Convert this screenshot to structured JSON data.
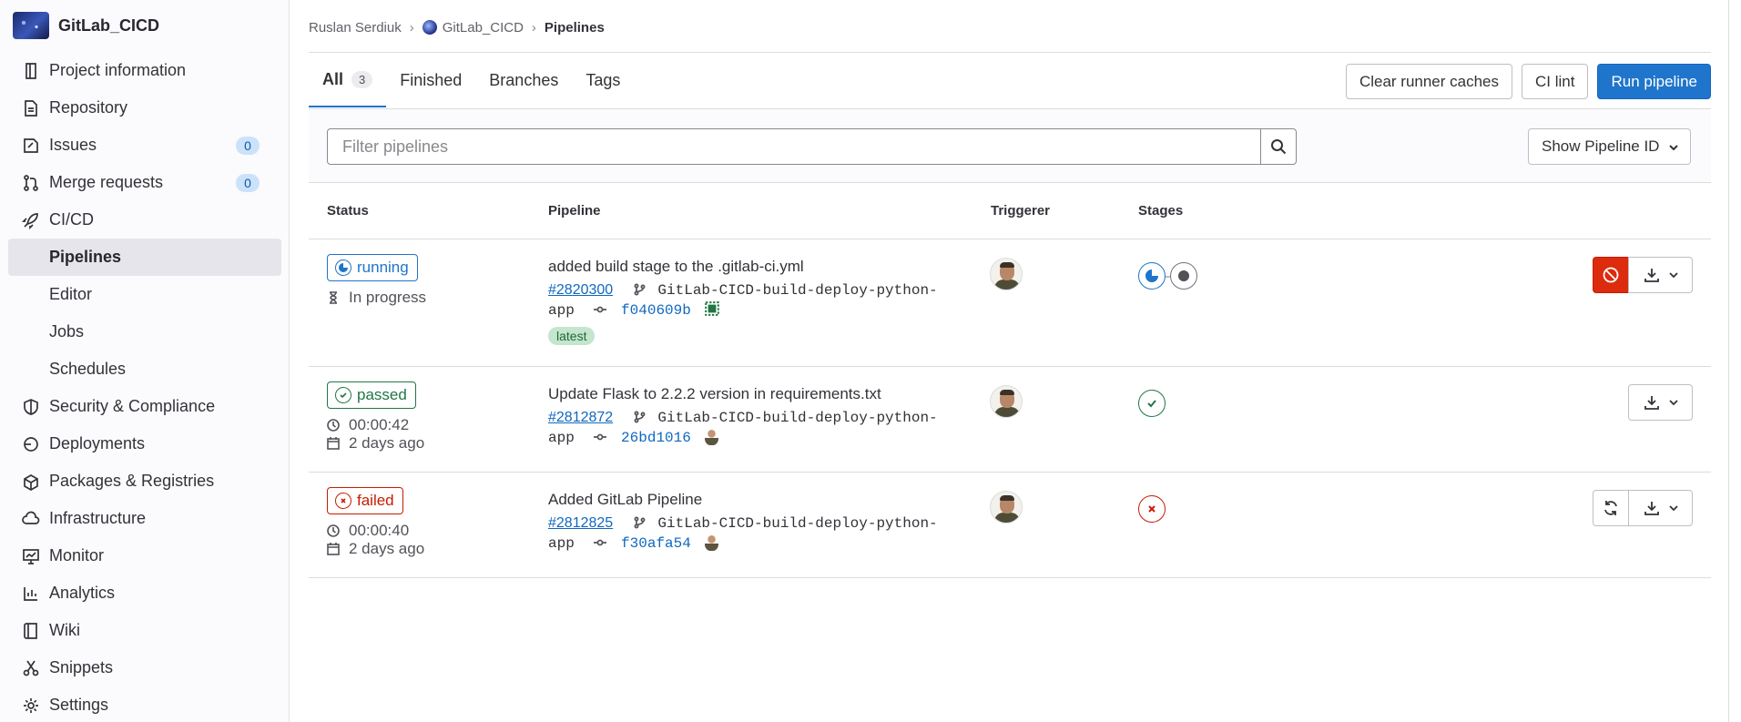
{
  "project": {
    "name": "GitLab_CICD"
  },
  "sidebar": {
    "items": [
      {
        "label": "Project information",
        "icon": "project-icon"
      },
      {
        "label": "Repository",
        "icon": "doc-icon"
      },
      {
        "label": "Issues",
        "icon": "issues-icon",
        "count": "0"
      },
      {
        "label": "Merge requests",
        "icon": "merge-request-icon",
        "count": "0"
      },
      {
        "label": "CI/CD",
        "icon": "rocket-icon"
      },
      {
        "label": "Pipelines"
      },
      {
        "label": "Editor"
      },
      {
        "label": "Jobs"
      },
      {
        "label": "Schedules"
      },
      {
        "label": "Security & Compliance",
        "icon": "shield-icon"
      },
      {
        "label": "Deployments",
        "icon": "deployments-icon"
      },
      {
        "label": "Packages & Registries",
        "icon": "package-icon"
      },
      {
        "label": "Infrastructure",
        "icon": "cloud-icon"
      },
      {
        "label": "Monitor",
        "icon": "monitor-icon"
      },
      {
        "label": "Analytics",
        "icon": "chart-icon"
      },
      {
        "label": "Wiki",
        "icon": "book-icon"
      },
      {
        "label": "Snippets",
        "icon": "scissors-icon"
      },
      {
        "label": "Settings",
        "icon": "gear-icon"
      }
    ]
  },
  "breadcrumb": {
    "user": "Ruslan Serdiuk",
    "project": "GitLab_CICD",
    "current": "Pipelines"
  },
  "tabs": {
    "all": "All",
    "all_count": "3",
    "finished": "Finished",
    "branches": "Branches",
    "tags": "Tags"
  },
  "actions": {
    "clear_caches": "Clear runner caches",
    "ci_lint": "CI lint",
    "run_pipeline": "Run pipeline"
  },
  "filter": {
    "placeholder": "Filter pipelines",
    "select": "Show Pipeline ID"
  },
  "table": {
    "headers": {
      "status": "Status",
      "pipeline": "Pipeline",
      "triggerer": "Triggerer",
      "stages": "Stages"
    },
    "rows": [
      {
        "status": "running",
        "meta1": "In progress",
        "title": "added build stage to the .gitlab-ci.yml",
        "id": "#2820300",
        "branch": "GitLab-CICD-build-deploy-python-app",
        "sha": "f040609b",
        "badge": "latest"
      },
      {
        "status": "passed",
        "meta1": "00:00:42",
        "meta2": "2 days ago",
        "title": "Update Flask to 2.2.2 version in requirements.txt",
        "id": "#2812872",
        "branch": "GitLab-CICD-build-deploy-python-app",
        "sha": "26bd1016"
      },
      {
        "status": "failed",
        "meta1": "00:00:40",
        "meta2": "2 days ago",
        "title": "Added GitLab Pipeline",
        "id": "#2812825",
        "branch": "GitLab-CICD-build-deploy-python-app",
        "sha": "f30afa54"
      }
    ]
  },
  "colors": {
    "accent": "#1f75cb",
    "success": "#217645",
    "danger": "#c91c00"
  }
}
